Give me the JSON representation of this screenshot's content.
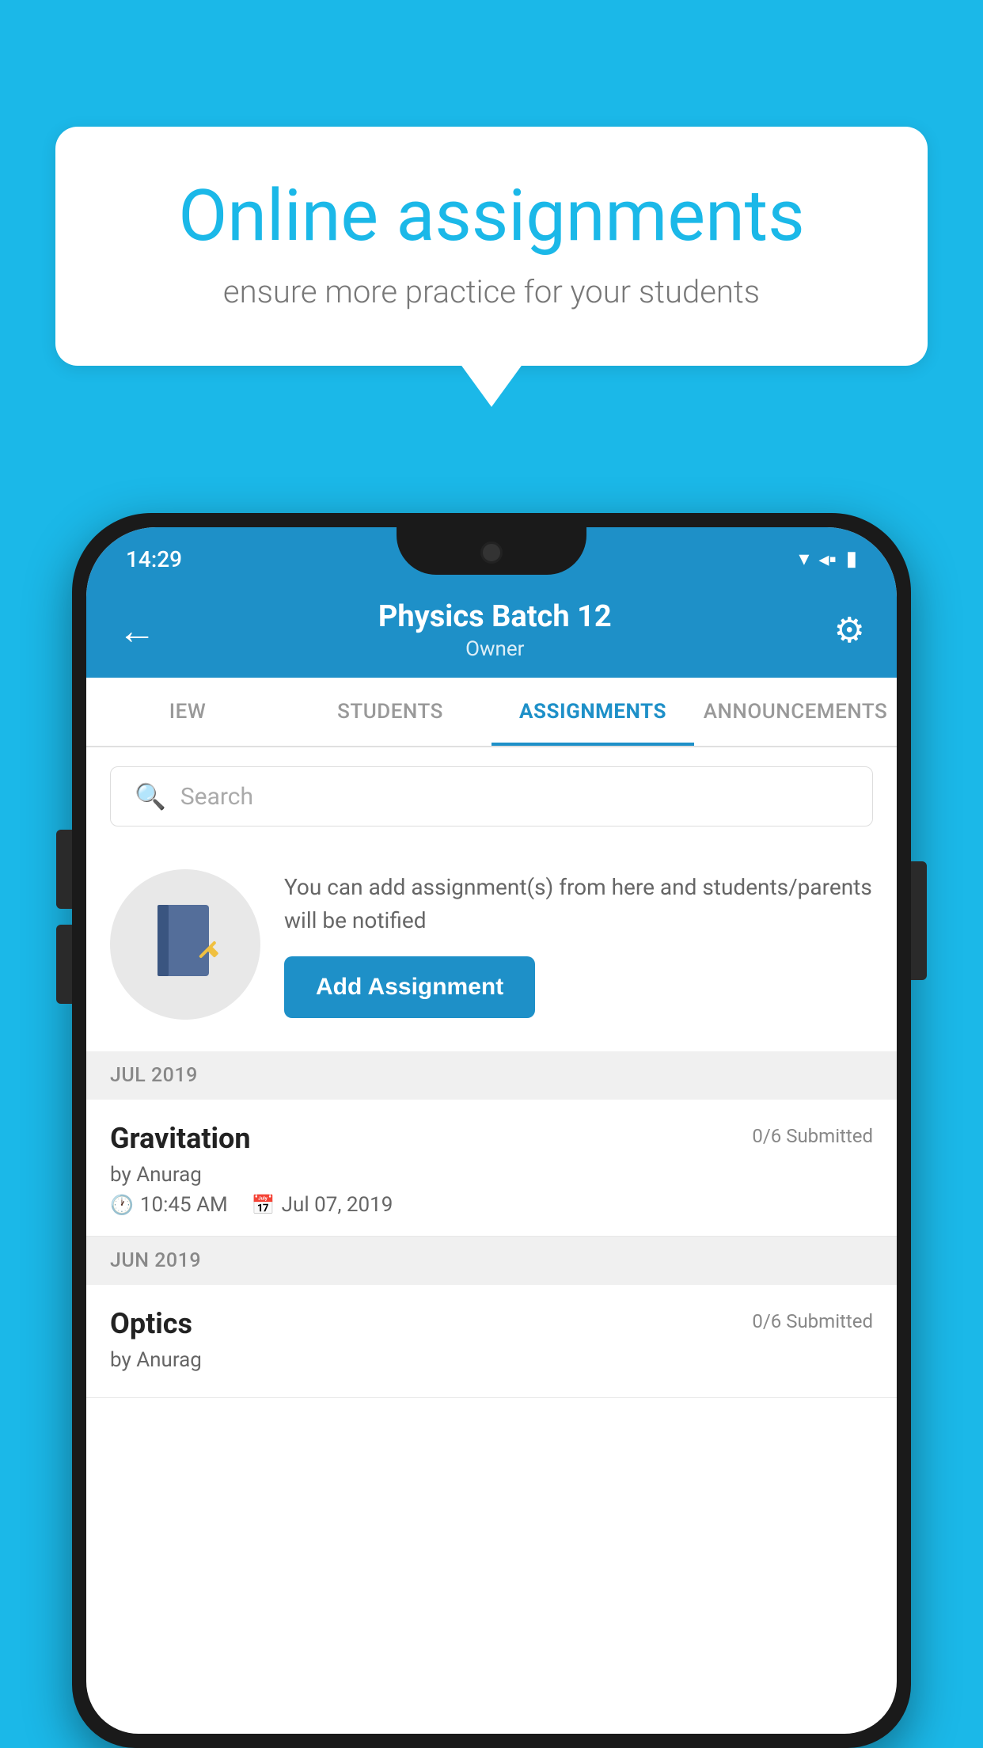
{
  "background_color": "#1BB8E8",
  "speech_bubble": {
    "title": "Online assignments",
    "subtitle": "ensure more practice for your students"
  },
  "status_bar": {
    "time": "14:29",
    "icons": [
      "wifi",
      "signal",
      "battery"
    ]
  },
  "header": {
    "title": "Physics Batch 12",
    "subtitle": "Owner",
    "back_label": "←",
    "settings_label": "⚙"
  },
  "tabs": [
    {
      "label": "IEW",
      "active": false
    },
    {
      "label": "STUDENTS",
      "active": false
    },
    {
      "label": "ASSIGNMENTS",
      "active": true
    },
    {
      "label": "ANNOUNCEMENTS",
      "active": false
    }
  ],
  "search": {
    "placeholder": "Search"
  },
  "promo": {
    "description": "You can add assignment(s) from here and students/parents will be notified",
    "button_label": "Add Assignment"
  },
  "sections": [
    {
      "month_label": "JUL 2019",
      "assignments": [
        {
          "name": "Gravitation",
          "submitted": "0/6 Submitted",
          "by": "by Anurag",
          "time": "10:45 AM",
          "date": "Jul 07, 2019"
        }
      ]
    },
    {
      "month_label": "JUN 2019",
      "assignments": [
        {
          "name": "Optics",
          "submitted": "0/6 Submitted",
          "by": "by Anurag",
          "time": "",
          "date": ""
        }
      ]
    }
  ]
}
